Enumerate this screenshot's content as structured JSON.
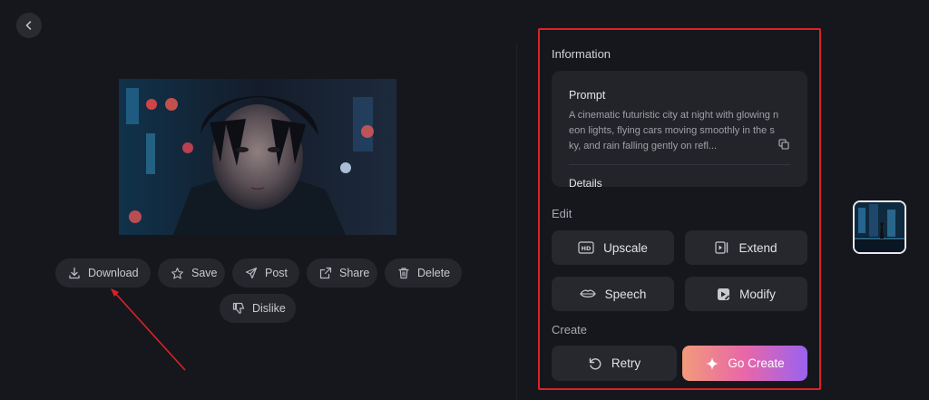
{
  "nav": {
    "back_icon": "chevron-left-icon"
  },
  "preview": {
    "alt": "Generated image preview"
  },
  "actions": {
    "download": "Download",
    "save": "Save",
    "post": "Post",
    "share": "Share",
    "delete": "Delete",
    "dislike": "Dislike"
  },
  "panel": {
    "information_title": "Information",
    "prompt_title": "Prompt",
    "prompt_text": "A cinematic futuristic city at night with glowing neon lights, flying cars moving smoothly in the sky, and rain falling gently on refl...",
    "details_title": "Details",
    "edit_title": "Edit",
    "edit_tools": {
      "upscale": "Upscale",
      "extend": "Extend",
      "speech": "Speech",
      "modify": "Modify"
    },
    "create_title": "Create",
    "retry": "Retry",
    "go_create": "Go Create"
  },
  "colors": {
    "background": "#16171c",
    "card": "#23242a",
    "highlight_border": "#d8232a",
    "annotation_arrow": "#d8232a",
    "gradient": [
      "#f29a7a",
      "#e867a8",
      "#9a62f0"
    ]
  }
}
